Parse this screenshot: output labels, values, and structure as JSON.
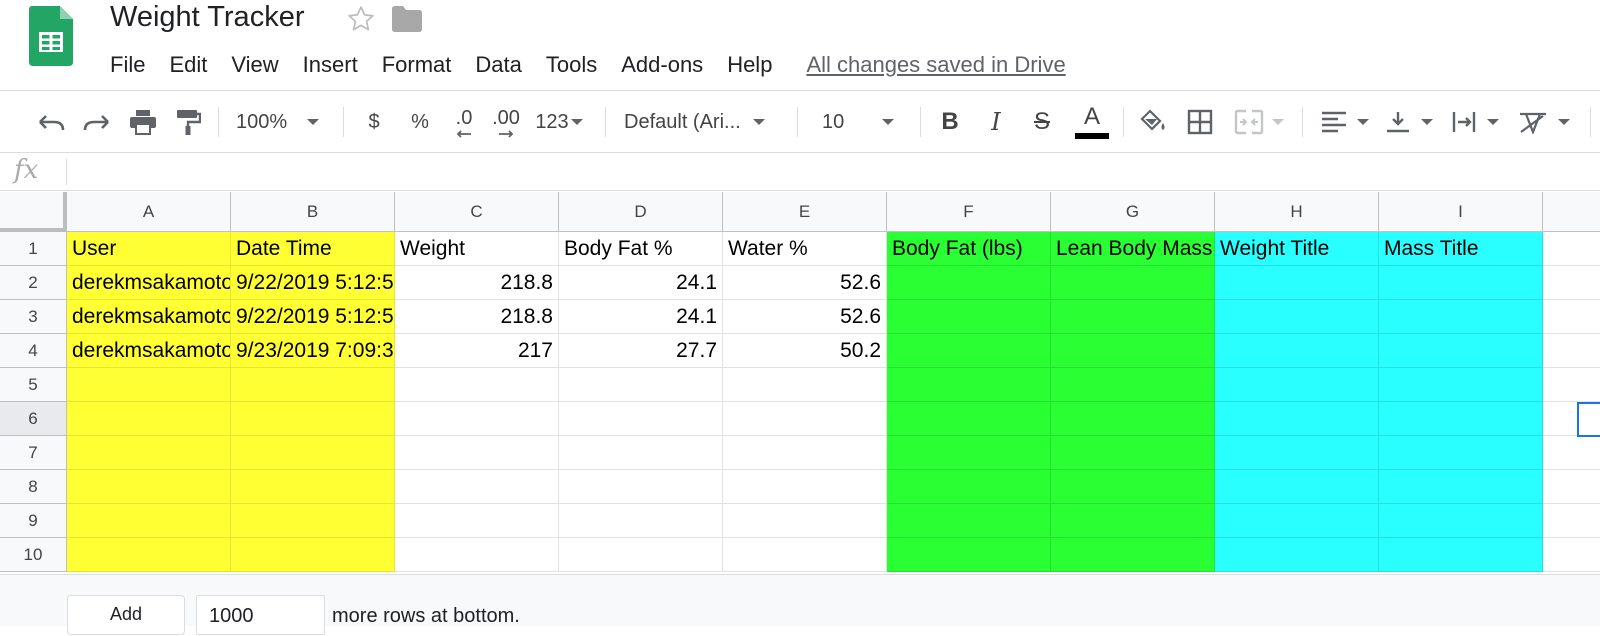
{
  "app": {
    "title": "Weight Tracker",
    "save_status": "All changes saved in Drive"
  },
  "menu": [
    "File",
    "Edit",
    "View",
    "Insert",
    "Format",
    "Data",
    "Tools",
    "Add-ons",
    "Help"
  ],
  "toolbar": {
    "zoom": "100%",
    "currency": "$",
    "percent": "%",
    "decrease_decimals": ".0",
    "increase_decimals": ".00",
    "more_formats": "123",
    "font": "Default (Ari...",
    "font_size": "10",
    "bold": "B",
    "italic": "I",
    "strike": "S",
    "text_color_glyph": "A",
    "text_color": "#000000"
  },
  "formula_bar": {
    "fx": "fx",
    "content": ""
  },
  "columns": [
    "A",
    "B",
    "C",
    "D",
    "E",
    "F",
    "G",
    "H",
    "I"
  ],
  "rows": [
    "1",
    "2",
    "3",
    "4",
    "5",
    "6",
    "7",
    "8",
    "9",
    "10"
  ],
  "cells": [
    [
      "User",
      "Date Time",
      "Weight",
      "Body Fat %",
      "Water %",
      "Body Fat (lbs)",
      "Lean Body Mass",
      "Weight Title",
      "Mass Title"
    ],
    [
      "derekmsakamoto",
      "9/22/2019 5:12:5",
      "218.8",
      "24.1",
      "52.6",
      "",
      "",
      "",
      ""
    ],
    [
      "derekmsakamoto",
      "9/22/2019 5:12:5",
      "218.8",
      "24.1",
      "52.6",
      "",
      "",
      "",
      ""
    ],
    [
      "derekmsakamoto",
      "9/23/2019 7:09:3",
      "217",
      "27.7",
      "50.2",
      "",
      "",
      "",
      ""
    ],
    [
      "",
      "",
      "",
      "",
      "",
      "",
      "",
      "",
      ""
    ],
    [
      "",
      "",
      "",
      "",
      "",
      "",
      "",
      "",
      ""
    ],
    [
      "",
      "",
      "",
      "",
      "",
      "",
      "",
      "",
      ""
    ],
    [
      "",
      "",
      "",
      "",
      "",
      "",
      "",
      "",
      ""
    ],
    [
      "",
      "",
      "",
      "",
      "",
      "",
      "",
      "",
      ""
    ],
    [
      "",
      "",
      "",
      "",
      "",
      "",
      "",
      "",
      ""
    ]
  ],
  "column_fills": {
    "A": "#ffff33",
    "B": "#ffff33",
    "F": "#29ff33",
    "G": "#29ff33",
    "H": "#29ffff",
    "I": "#29ffff"
  },
  "bottom": {
    "add_label": "Add",
    "rows_value": "1000",
    "rows_suffix": "more rows at bottom."
  }
}
